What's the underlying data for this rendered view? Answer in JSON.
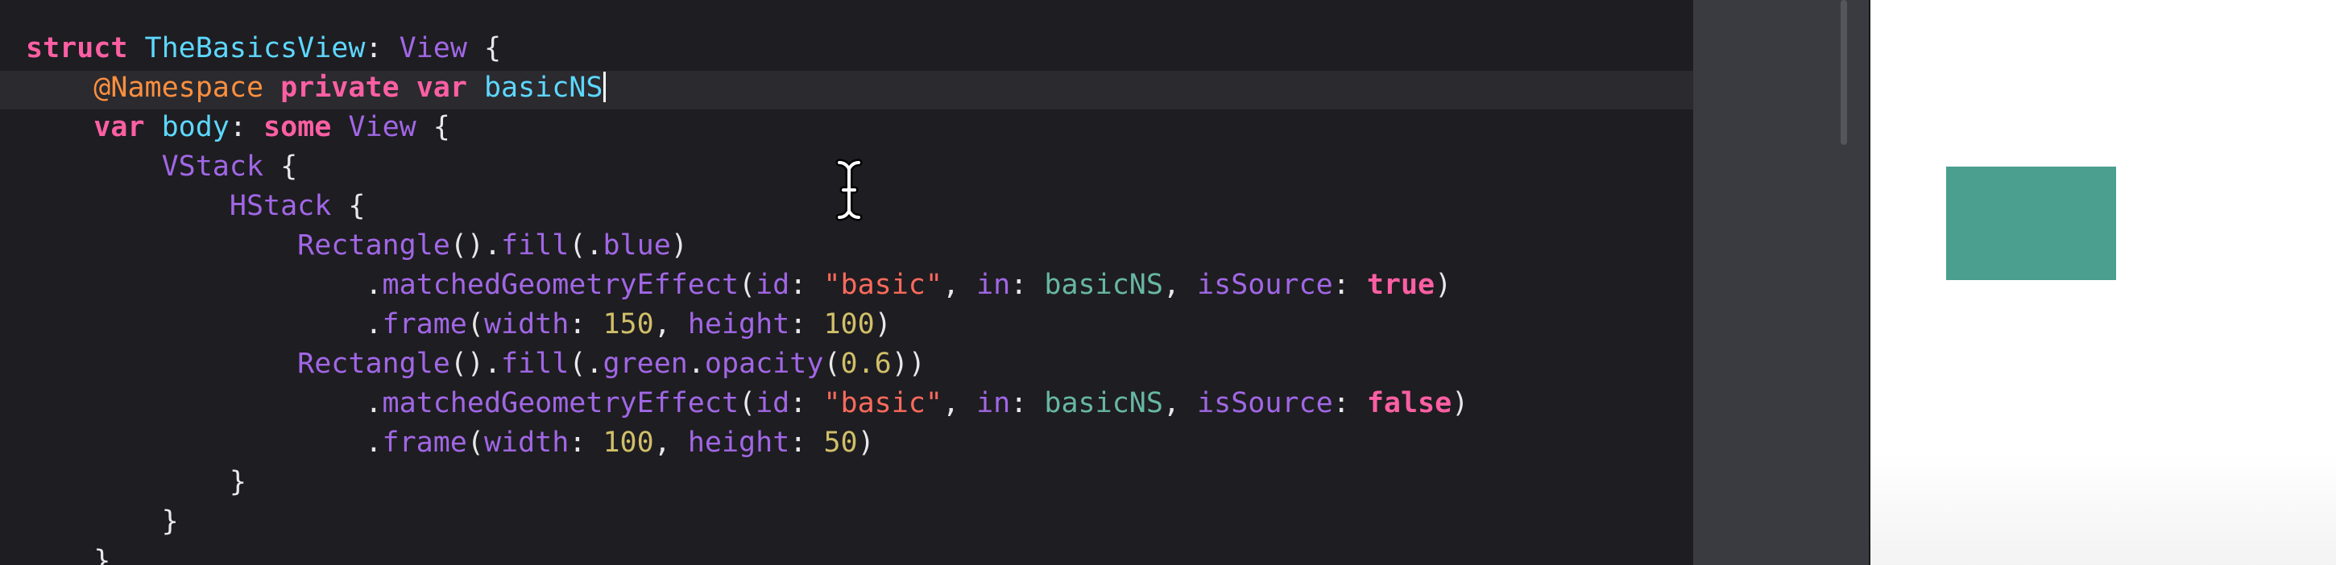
{
  "editor": {
    "lines": [
      [
        {
          "t": "struct",
          "c": "kw"
        },
        {
          "t": " ",
          "c": "pl"
        },
        {
          "t": "TheBasicsView",
          "c": "ty"
        },
        {
          "t": ": ",
          "c": "pl"
        },
        {
          "t": "View",
          "c": "fn"
        },
        {
          "t": " {",
          "c": "pl"
        }
      ],
      [
        {
          "t": "    ",
          "c": "pl"
        },
        {
          "t": "@Namespace",
          "c": "at"
        },
        {
          "t": " ",
          "c": "pl"
        },
        {
          "t": "private",
          "c": "kw"
        },
        {
          "t": " ",
          "c": "pl"
        },
        {
          "t": "var",
          "c": "kw"
        },
        {
          "t": " ",
          "c": "pl"
        },
        {
          "t": "basicNS",
          "c": "ty"
        }
      ],
      [
        {
          "t": "    ",
          "c": "pl"
        },
        {
          "t": "var",
          "c": "kw"
        },
        {
          "t": " ",
          "c": "pl"
        },
        {
          "t": "body",
          "c": "ty"
        },
        {
          "t": ": ",
          "c": "pl"
        },
        {
          "t": "some",
          "c": "kw"
        },
        {
          "t": " ",
          "c": "pl"
        },
        {
          "t": "View",
          "c": "fn"
        },
        {
          "t": " {",
          "c": "pl"
        }
      ],
      [
        {
          "t": "        ",
          "c": "pl"
        },
        {
          "t": "VStack",
          "c": "fn"
        },
        {
          "t": " {",
          "c": "pl"
        }
      ],
      [
        {
          "t": "            ",
          "c": "pl"
        },
        {
          "t": "HStack",
          "c": "fn"
        },
        {
          "t": " {",
          "c": "pl"
        }
      ],
      [
        {
          "t": "                ",
          "c": "pl"
        },
        {
          "t": "Rectangle",
          "c": "fn"
        },
        {
          "t": "().",
          "c": "pl"
        },
        {
          "t": "fill",
          "c": "fn"
        },
        {
          "t": "(.",
          "c": "pl"
        },
        {
          "t": "blue",
          "c": "fn"
        },
        {
          "t": ")",
          "c": "pl"
        }
      ],
      [
        {
          "t": "                    .",
          "c": "pl"
        },
        {
          "t": "matchedGeometryEffect",
          "c": "fn"
        },
        {
          "t": "(",
          "c": "pl"
        },
        {
          "t": "id",
          "c": "fn"
        },
        {
          "t": ": ",
          "c": "pl"
        },
        {
          "t": "\"basic\"",
          "c": "str"
        },
        {
          "t": ", ",
          "c": "pl"
        },
        {
          "t": "in",
          "c": "fn"
        },
        {
          "t": ": ",
          "c": "pl"
        },
        {
          "t": "basicNS",
          "c": "id"
        },
        {
          "t": ", ",
          "c": "pl"
        },
        {
          "t": "isSource",
          "c": "fn"
        },
        {
          "t": ": ",
          "c": "pl"
        },
        {
          "t": "true",
          "c": "kw"
        },
        {
          "t": ")",
          "c": "pl"
        }
      ],
      [
        {
          "t": "                    .",
          "c": "pl"
        },
        {
          "t": "frame",
          "c": "fn"
        },
        {
          "t": "(",
          "c": "pl"
        },
        {
          "t": "width",
          "c": "fn"
        },
        {
          "t": ": ",
          "c": "pl"
        },
        {
          "t": "150",
          "c": "num"
        },
        {
          "t": ", ",
          "c": "pl"
        },
        {
          "t": "height",
          "c": "fn"
        },
        {
          "t": ": ",
          "c": "pl"
        },
        {
          "t": "100",
          "c": "num"
        },
        {
          "t": ")",
          "c": "pl"
        }
      ],
      [
        {
          "t": "                ",
          "c": "pl"
        },
        {
          "t": "Rectangle",
          "c": "fn"
        },
        {
          "t": "().",
          "c": "pl"
        },
        {
          "t": "fill",
          "c": "fn"
        },
        {
          "t": "(.",
          "c": "pl"
        },
        {
          "t": "green",
          "c": "fn"
        },
        {
          "t": ".",
          "c": "pl"
        },
        {
          "t": "opacity",
          "c": "fn"
        },
        {
          "t": "(",
          "c": "pl"
        },
        {
          "t": "0.6",
          "c": "num"
        },
        {
          "t": "))",
          "c": "pl"
        }
      ],
      [
        {
          "t": "                    .",
          "c": "pl"
        },
        {
          "t": "matchedGeometryEffect",
          "c": "fn"
        },
        {
          "t": "(",
          "c": "pl"
        },
        {
          "t": "id",
          "c": "fn"
        },
        {
          "t": ": ",
          "c": "pl"
        },
        {
          "t": "\"basic\"",
          "c": "str"
        },
        {
          "t": ", ",
          "c": "pl"
        },
        {
          "t": "in",
          "c": "fn"
        },
        {
          "t": ": ",
          "c": "pl"
        },
        {
          "t": "basicNS",
          "c": "id"
        },
        {
          "t": ", ",
          "c": "pl"
        },
        {
          "t": "isSource",
          "c": "fn"
        },
        {
          "t": ": ",
          "c": "pl"
        },
        {
          "t": "false",
          "c": "kw"
        },
        {
          "t": ")",
          "c": "pl"
        }
      ],
      [
        {
          "t": "                    .",
          "c": "pl"
        },
        {
          "t": "frame",
          "c": "fn"
        },
        {
          "t": "(",
          "c": "pl"
        },
        {
          "t": "width",
          "c": "fn"
        },
        {
          "t": ": ",
          "c": "pl"
        },
        {
          "t": "100",
          "c": "num"
        },
        {
          "t": ", ",
          "c": "pl"
        },
        {
          "t": "height",
          "c": "fn"
        },
        {
          "t": ": ",
          "c": "pl"
        },
        {
          "t": "50",
          "c": "num"
        },
        {
          "t": ")",
          "c": "pl"
        }
      ],
      [
        {
          "t": "            }",
          "c": "pl"
        }
      ],
      [
        {
          "t": "        }",
          "c": "pl"
        }
      ],
      [
        {
          "t": "    }",
          "c": "pl"
        }
      ]
    ],
    "caret_line": 1,
    "icons": {
      "cursor": "text-ibeam-cursor-icon"
    }
  },
  "preview": {
    "shape": "rectangle",
    "fill_color": "#4a9f8f"
  },
  "colors": {
    "editor_bg": "#1e1d21",
    "current_line": "#2a2a2f",
    "canvas_bg": "#ffffff"
  }
}
